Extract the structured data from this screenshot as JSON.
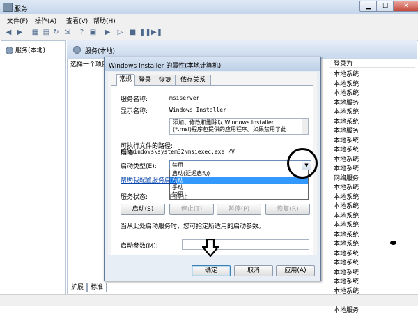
{
  "window": {
    "title": "服务",
    "controls": {
      "minimize": "▁",
      "maximize": "☐",
      "close": "✕"
    }
  },
  "menu": [
    "文件(F)",
    "操作(A)",
    "查看(V)",
    "帮助(H)"
  ],
  "tree": {
    "root": "服务(本地)"
  },
  "main": {
    "header": "服务(本地)",
    "select_hint": "选择一个项目",
    "column_header": "登录为",
    "logon_values": [
      "本地系统",
      "本地系统",
      "本地系统",
      "本地服务",
      "本地系统",
      "本地系统",
      "本地服务",
      "本地系统",
      "本地系统",
      "本地系统",
      "本地系统",
      "网络服务",
      "本地系统",
      "本地系统",
      "本地系统",
      "本地系统",
      "本地系统",
      "本地系统",
      "本地系统",
      "本地系统",
      "本地系统",
      "本地系统",
      "本地系统",
      "本地系统",
      "本地服务",
      "本地服务"
    ]
  },
  "bottom_tabs": [
    "扩展",
    "标准"
  ],
  "dialog": {
    "title": "Windows Installer 的属性(本地计算机)",
    "tabs": [
      "常规",
      "登录",
      "恢复",
      "依存关系"
    ],
    "service_name_label": "服务名称:",
    "service_name": "msiserver",
    "display_name_label": "显示名称:",
    "display_name": "Windows Installer",
    "description_label": "描述:",
    "description_line1": "添加、修改和删除以 Windows Installer",
    "description_line2": "(*.msi)程序包提供的应用程序。如果禁用了此",
    "exec_path_label": "可执行文件的路径:",
    "exec_path": "C:\\windows\\system32\\msiexec.exe /V",
    "startup_type_label": "启动类型(E):",
    "startup_type_value": "禁用",
    "startup_options": [
      "启动(延迟启动)",
      "自动",
      "手动",
      "禁用"
    ],
    "help_link": "帮助我配置服务启动",
    "status_label": "服务状态:",
    "status_value": "已停止",
    "buttons": {
      "start": "启动(S)",
      "stop": "停止(T)",
      "pause": "暂停(P)",
      "resume": "恢复(R)"
    },
    "hint": "当从此处启动服务时，您可指定所适用的启动参数。",
    "params_label": "启动参数(M):",
    "ok": "确定",
    "cancel": "取消",
    "apply": "应用(A)"
  }
}
